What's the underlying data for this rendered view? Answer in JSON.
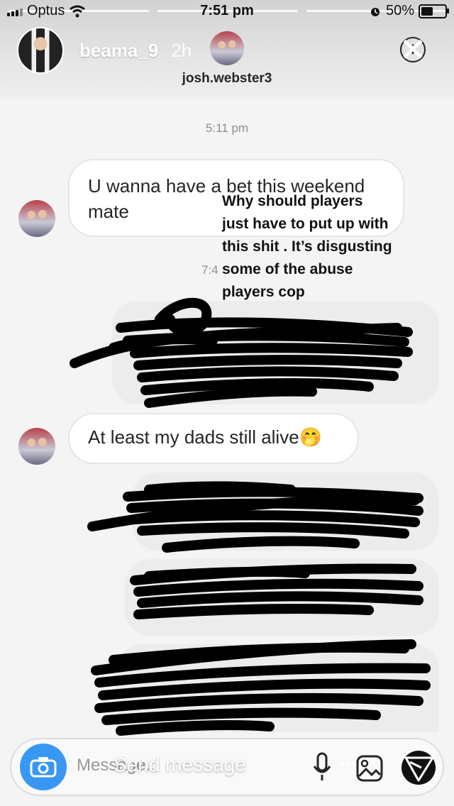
{
  "status_bar": {
    "carrier": "Optus",
    "time": "7:51 pm",
    "battery": "50%",
    "battery_level": 0.5
  },
  "story": {
    "username": "beama_9",
    "age": "2h",
    "caption_lines": [
      "Why should players",
      "just have to put up with",
      "this shit . It’s disgusting",
      "some of the abuse",
      "players cop"
    ],
    "reply_placeholder": "Send message"
  },
  "dm": {
    "contact_name": "josh.webster3",
    "messages": [
      {
        "type": "timestamp",
        "text": "5:11 pm"
      },
      {
        "type": "incoming",
        "text": "U wanna have a bet this weekend mate"
      },
      {
        "type": "timestamp",
        "text": "7:4"
      },
      {
        "type": "outgoing-redacted"
      },
      {
        "type": "incoming",
        "text": "At least my dads still alive",
        "emoji": "🤭"
      },
      {
        "type": "outgoing-redacted"
      },
      {
        "type": "outgoing-redacted"
      },
      {
        "type": "outgoing-redacted"
      }
    ],
    "composer": {
      "placeholder": "Message..."
    }
  },
  "icons": {
    "camera": "camera-icon",
    "mic": "mic-icon",
    "gallery": "gallery-icon",
    "send": "direct-send-icon",
    "close": "close-icon",
    "info": "info-icon"
  },
  "colors": {
    "camera_button": "#3897f0",
    "incoming_bubble": "#ffffff",
    "outgoing_bubble": "#ececec",
    "scribble": "#000000"
  }
}
